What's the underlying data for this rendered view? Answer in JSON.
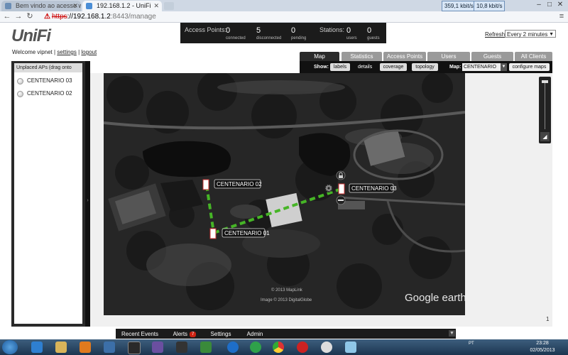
{
  "browser": {
    "tabs": [
      {
        "title": "Bem vindo ao acesso web",
        "active": false
      },
      {
        "title": "192.168.1.2 - UniFi",
        "active": true
      }
    ],
    "net_meters": [
      "359,1 kbit/s",
      "10,8 kbit/s"
    ],
    "url": {
      "scheme": "https",
      "host": "192.168.1.2",
      "rest": ":8443/manage"
    }
  },
  "app": {
    "logo": "UniFi",
    "welcome": "Welcome vipnet",
    "settings_link": "settings",
    "logout_link": "logout",
    "refresh_label": "Refresh",
    "refresh_value": "Every 2 minutes"
  },
  "stats": {
    "access_points_label": "Access Points:",
    "stations_label": "Stations:",
    "ap": [
      {
        "value": "0",
        "caption": "connected"
      },
      {
        "value": "5",
        "caption": "disconnected"
      },
      {
        "value": "0",
        "caption": "pending"
      }
    ],
    "st": [
      {
        "value": "0",
        "caption": "users"
      },
      {
        "value": "0",
        "caption": "guests"
      }
    ]
  },
  "tabs": [
    "Map",
    "Statistics",
    "Access Points",
    "Users",
    "Guests",
    "All Clients"
  ],
  "map_toolbar": {
    "show_label": "Show:",
    "options": [
      "labels",
      "details",
      "coverage",
      "topology"
    ],
    "map_label": "Map:",
    "map_value": "CENTENARIO",
    "configure_label": "configure maps"
  },
  "unplaced": {
    "title": "Unplaced APs (drag onto map)",
    "items": [
      "CENTENARIO 03",
      "CENTENARIO 02"
    ]
  },
  "map": {
    "aps": [
      {
        "label": "CENTENARIO 02"
      },
      {
        "label": "CENTENARIO 01"
      },
      {
        "label": "CENTENARIO 03"
      }
    ],
    "copyright1": "© 2013 MapLink",
    "copyright2": "Image © 2013 DigitalGlobe",
    "watermark": "Google earth",
    "corner_label": "1"
  },
  "bottom_tabs": {
    "recent_events": "Recent Events",
    "alerts": "Alerts",
    "alerts_count": "7",
    "settings": "Settings",
    "admin": "Admin"
  },
  "taskbar": {
    "time": "23:28",
    "date": "02/05/2013",
    "tray_text": "PT"
  },
  "colors": {
    "link_green": "#46b526",
    "panel_dark": "#2a2a2a",
    "alert_red": "#cc2211"
  }
}
